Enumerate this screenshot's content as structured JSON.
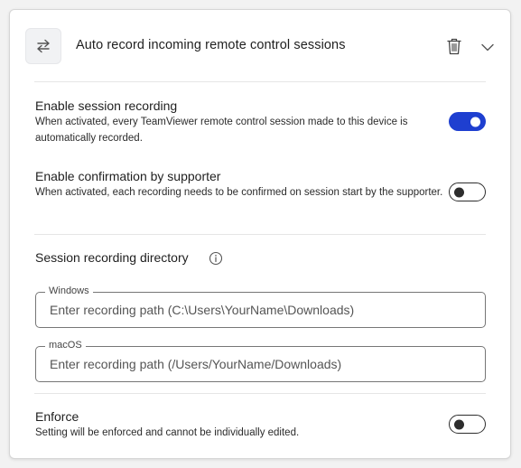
{
  "header": {
    "icon": "swap-arrows-icon",
    "title": "Auto record incoming remote control sessions",
    "delete_icon": "trash-icon",
    "expand_icon": "chevron-down-icon"
  },
  "session_recording": {
    "title": "Enable session recording",
    "description": "When activated, every TeamViewer remote control session made to this device is automatically recorded.",
    "enabled": true
  },
  "confirmation": {
    "title": "Enable confirmation by supporter",
    "description": "When activated, each recording needs to be confirmed on session start by the supporter.",
    "enabled": false
  },
  "directory": {
    "title": "Session recording directory",
    "info_icon": "info-icon",
    "windows": {
      "label": "Windows",
      "value": "",
      "placeholder": "Enter recording path (C:\\Users\\YourName\\Downloads)"
    },
    "macos": {
      "label": "macOS",
      "value": "",
      "placeholder": "Enter recording path (/Users/YourName/Downloads)"
    }
  },
  "enforce": {
    "title": "Enforce",
    "description": "Setting will be enforced and cannot be individually edited.",
    "enabled": false
  },
  "colors": {
    "toggle_on": "#1e3fd0",
    "toggle_off_outline": "#2d2d2d",
    "field_border": "#767676"
  }
}
